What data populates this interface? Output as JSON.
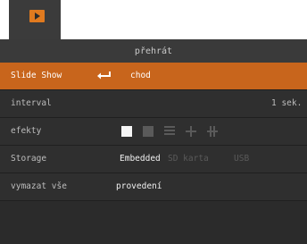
{
  "header": {
    "title": "přehrát"
  },
  "menu": {
    "slideshow": {
      "label": "Slide Show",
      "value": "chod"
    },
    "interval": {
      "label": "interval",
      "value": "1 sek."
    },
    "effects": {
      "label": "efekty"
    },
    "storage": {
      "label": "Storage",
      "options": [
        "Embedded",
        "SD karta",
        "USB"
      ]
    },
    "clear": {
      "label": "vymazat vše",
      "value": "provedení"
    }
  },
  "colors": {
    "accent": "#c8651c",
    "icon": "#e07a1f"
  }
}
